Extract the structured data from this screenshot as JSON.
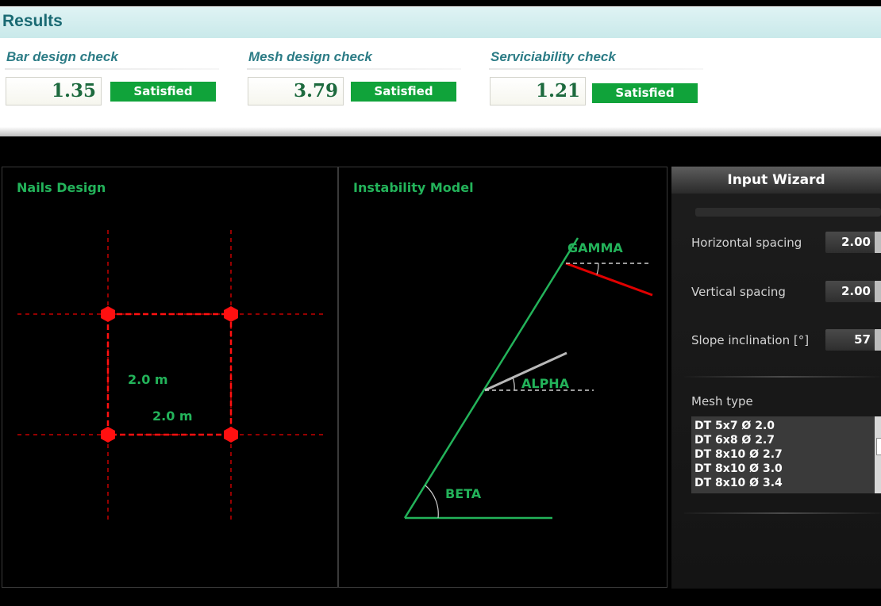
{
  "results": {
    "title": "Results",
    "checks": [
      {
        "label": "Bar design check",
        "value": "1.35",
        "status": "Satisfied"
      },
      {
        "label": "Mesh design check",
        "value": "3.79",
        "status": "Satisfied"
      },
      {
        "label": "Serviciability check",
        "value": "1.21",
        "status": "Satisfied"
      }
    ]
  },
  "nails_design": {
    "title": "Nails Design",
    "vertical_spacing_label": "2.0 m",
    "horizontal_spacing_label": "2.0 m"
  },
  "instability_model": {
    "title": "Instability Model",
    "labels": {
      "gamma": "GAMMA",
      "alpha": "ALPHA",
      "beta": "BETA"
    }
  },
  "wizard": {
    "title": "Input Wizard",
    "fields": [
      {
        "label": "Horizontal spacing",
        "value": "2.00"
      },
      {
        "label": "Vertical spacing",
        "value": "2.00"
      },
      {
        "label": "Slope inclination [°]",
        "value": "57"
      }
    ],
    "mesh": {
      "label": "Mesh type",
      "options": [
        "DT 5x7 Ø 2.0",
        "DT 6x8 Ø 2.7",
        "DT 8x10 Ø 2.7",
        "DT 8x10 Ø 3.0",
        "DT 8x10 Ø 3.4"
      ]
    }
  },
  "colors": {
    "accent_green": "#23b35a",
    "satisfied_green": "#10a33a",
    "nail_red": "#e00000",
    "results_header": "#c9e9ea"
  }
}
